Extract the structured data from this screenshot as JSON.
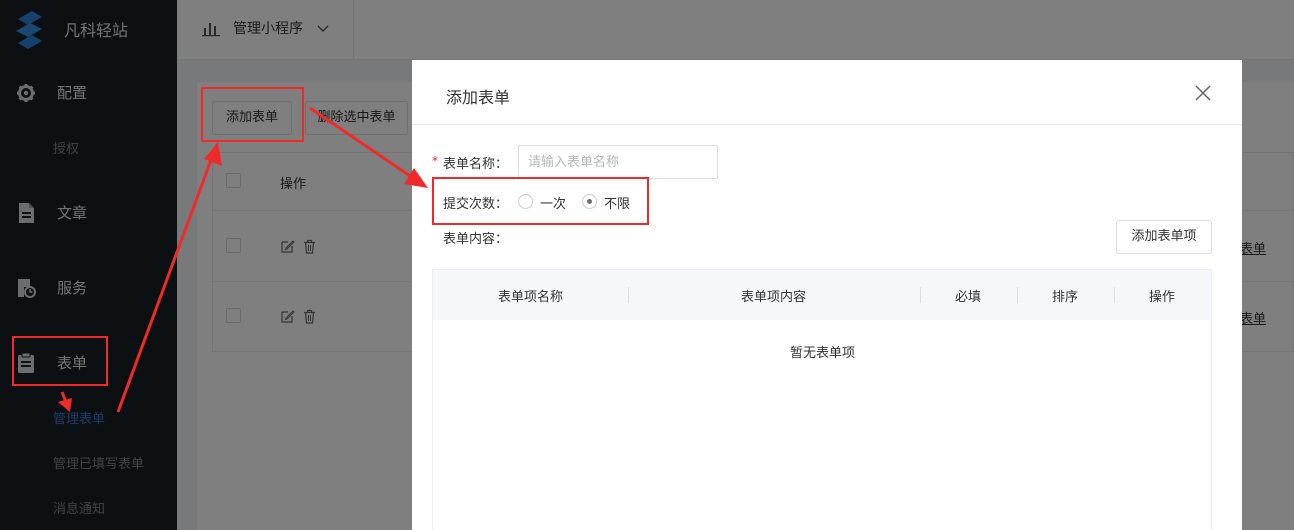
{
  "app": {
    "name": "凡科轻站"
  },
  "sidebar": {
    "items": [
      {
        "label": "配置",
        "icon": "gear-icon"
      },
      {
        "label": "文章",
        "icon": "document-icon"
      },
      {
        "label": "服务",
        "icon": "service-icon"
      },
      {
        "label": "表单",
        "icon": "clipboard-icon"
      }
    ],
    "sub": {
      "authorize": "授权",
      "manage_forms": "管理表单",
      "manage_filled": "管理已填写表单",
      "notifications": "消息通知"
    }
  },
  "topbar": {
    "tab_label": "管理小程序"
  },
  "background": {
    "add_form_btn": "添加表单",
    "delete_selected_btn": "删除选中表单",
    "table_header_action": "操作",
    "row_link": "表单"
  },
  "modal": {
    "title": "添加表单",
    "name_label": "表单名称：",
    "name_placeholder": "请输入表单名称",
    "submit_label": "提交次数：",
    "radio_once": "一次",
    "radio_unlimited": "不限",
    "selected_radio": "不限",
    "content_label": "表单内容：",
    "add_item_btn": "添加表单项",
    "table": {
      "headers": [
        "表单项名称",
        "表单项内容",
        "必填",
        "排序",
        "操作"
      ],
      "empty_text": "暂无表单项"
    }
  },
  "colors": {
    "annotation_red": "#f02a2a",
    "sidebar_bg": "#1b2127",
    "active_link": "#3c78d8"
  }
}
